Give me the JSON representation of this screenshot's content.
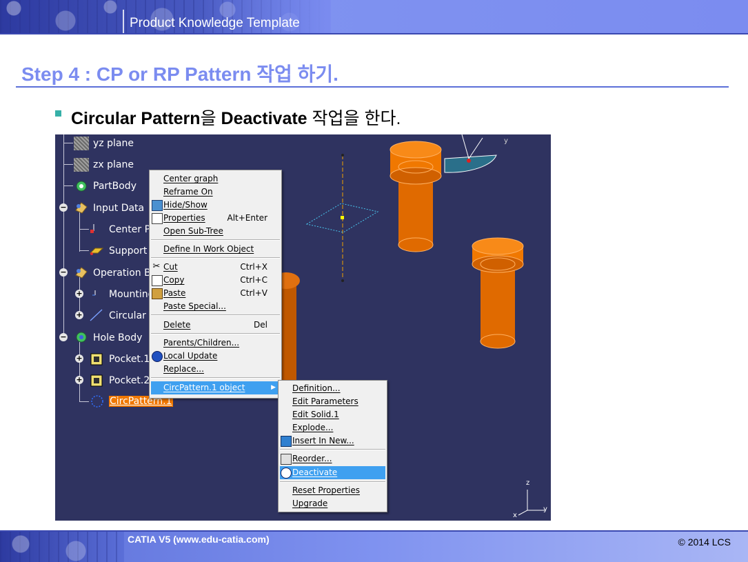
{
  "header": {
    "title": "Product Knowledge Template"
  },
  "step_title": "Step 4 : CP or RP Pattern 작업 하기.",
  "bullet": {
    "strong1": "Circular Pattern",
    "mid": "을 ",
    "strong2": "Deactivate",
    "tail": " 작업을 한다."
  },
  "tree": {
    "items": [
      {
        "label": "yz plane"
      },
      {
        "label": "zx plane"
      },
      {
        "label": "PartBody"
      },
      {
        "label": "Input Data"
      },
      {
        "label": "Center Po"
      },
      {
        "label": "Support P"
      },
      {
        "label": "Operation Bo"
      },
      {
        "label": "Mounting"
      },
      {
        "label": "Circular P"
      },
      {
        "label": "Hole Body"
      },
      {
        "label": "Pocket.1"
      },
      {
        "label": "Pocket.2"
      },
      {
        "label": "CircPattern.1"
      }
    ]
  },
  "context_menu": {
    "items": [
      {
        "label": "Center graph",
        "shortcut": ""
      },
      {
        "label": "Reframe On",
        "shortcut": ""
      },
      {
        "label": "Hide/Show",
        "shortcut": "",
        "icon": "hide-show-icon"
      },
      {
        "label": "Properties",
        "shortcut": "Alt+Enter",
        "icon": "properties-icon"
      },
      {
        "label": "Open Sub-Tree",
        "shortcut": ""
      },
      {
        "label": "Define In Work Object",
        "shortcut": ""
      },
      {
        "label": "Cut",
        "shortcut": "Ctrl+X",
        "icon": "scissors-icon"
      },
      {
        "label": "Copy",
        "shortcut": "Ctrl+C",
        "icon": "copy-icon"
      },
      {
        "label": "Paste",
        "shortcut": "Ctrl+V",
        "icon": "paste-icon"
      },
      {
        "label": "Paste Special...",
        "shortcut": ""
      },
      {
        "label": "Delete",
        "shortcut": "Del"
      },
      {
        "label": "Parents/Children...",
        "shortcut": ""
      },
      {
        "label": "Local Update",
        "shortcut": "",
        "icon": "update-icon"
      },
      {
        "label": "Replace...",
        "shortcut": ""
      },
      {
        "label": "CircPattern.1 object",
        "shortcut": ""
      }
    ]
  },
  "sub_menu": {
    "items": [
      {
        "label": "Definition..."
      },
      {
        "label": "Edit Parameters"
      },
      {
        "label": "Edit Solid.1"
      },
      {
        "label": "Explode..."
      },
      {
        "label": "Insert In New...",
        "icon": "insert-icon"
      },
      {
        "label": "Reorder...",
        "icon": "reorder-icon"
      },
      {
        "label": "Deactivate",
        "icon": "deactivate-icon"
      },
      {
        "label": "Reset Properties"
      },
      {
        "label": "Upgrade"
      }
    ]
  },
  "axis": {
    "x": "x",
    "y": "y",
    "z": "z"
  },
  "footer": {
    "left": "CATIA V5 (www.edu-catia.com)",
    "right": "© 2014 LCS"
  },
  "colors": {
    "accent": "#7b8cf0",
    "viewport_bg": "#2f3360",
    "highlight": "#3fa0f0",
    "part_orange": "#f07800"
  }
}
